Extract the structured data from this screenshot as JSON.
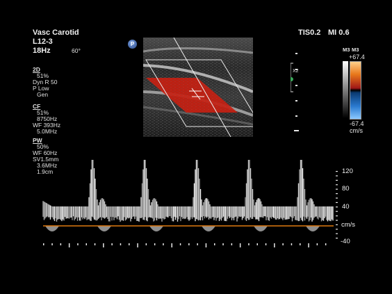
{
  "header": {
    "preset": "Vasc Carotid",
    "probe": "L12-3",
    "frame_rate": "18Hz",
    "angle": "60°",
    "tis": "TIS0.2",
    "mi": "MI 0.6"
  },
  "mode_2d": {
    "title": "2D",
    "gain": "51%",
    "dyn_range": "Dyn R 50",
    "power": "P Low",
    "preset": "Gen"
  },
  "mode_cf": {
    "title": "CF",
    "gain": "51%",
    "prf": "8750Hz",
    "wall_filter": "WF 393Hz",
    "frequency": "5.0MHz"
  },
  "mode_pw": {
    "title": "PW",
    "gain": "50%",
    "wall_filter": "WF  60Hz",
    "sample_volume": "SV1.5mm",
    "frequency": "3.6MHz",
    "depth": "1.9cm"
  },
  "color_scale": {
    "label_left": "M3",
    "label_right": "M3",
    "max": "+67.4",
    "min": "-67.4",
    "unit": "cm/s"
  },
  "depth_marker": {
    "zoom": "X2"
  },
  "p_badge": "P",
  "doppler_scale": {
    "labels": [
      "120",
      "80",
      "40",
      "cm/s",
      "-40"
    ],
    "unit": "cm/s"
  },
  "colors": {
    "baseline": "#e07a10",
    "color_box": "#c81e10",
    "waveform": "#ffffff"
  }
}
